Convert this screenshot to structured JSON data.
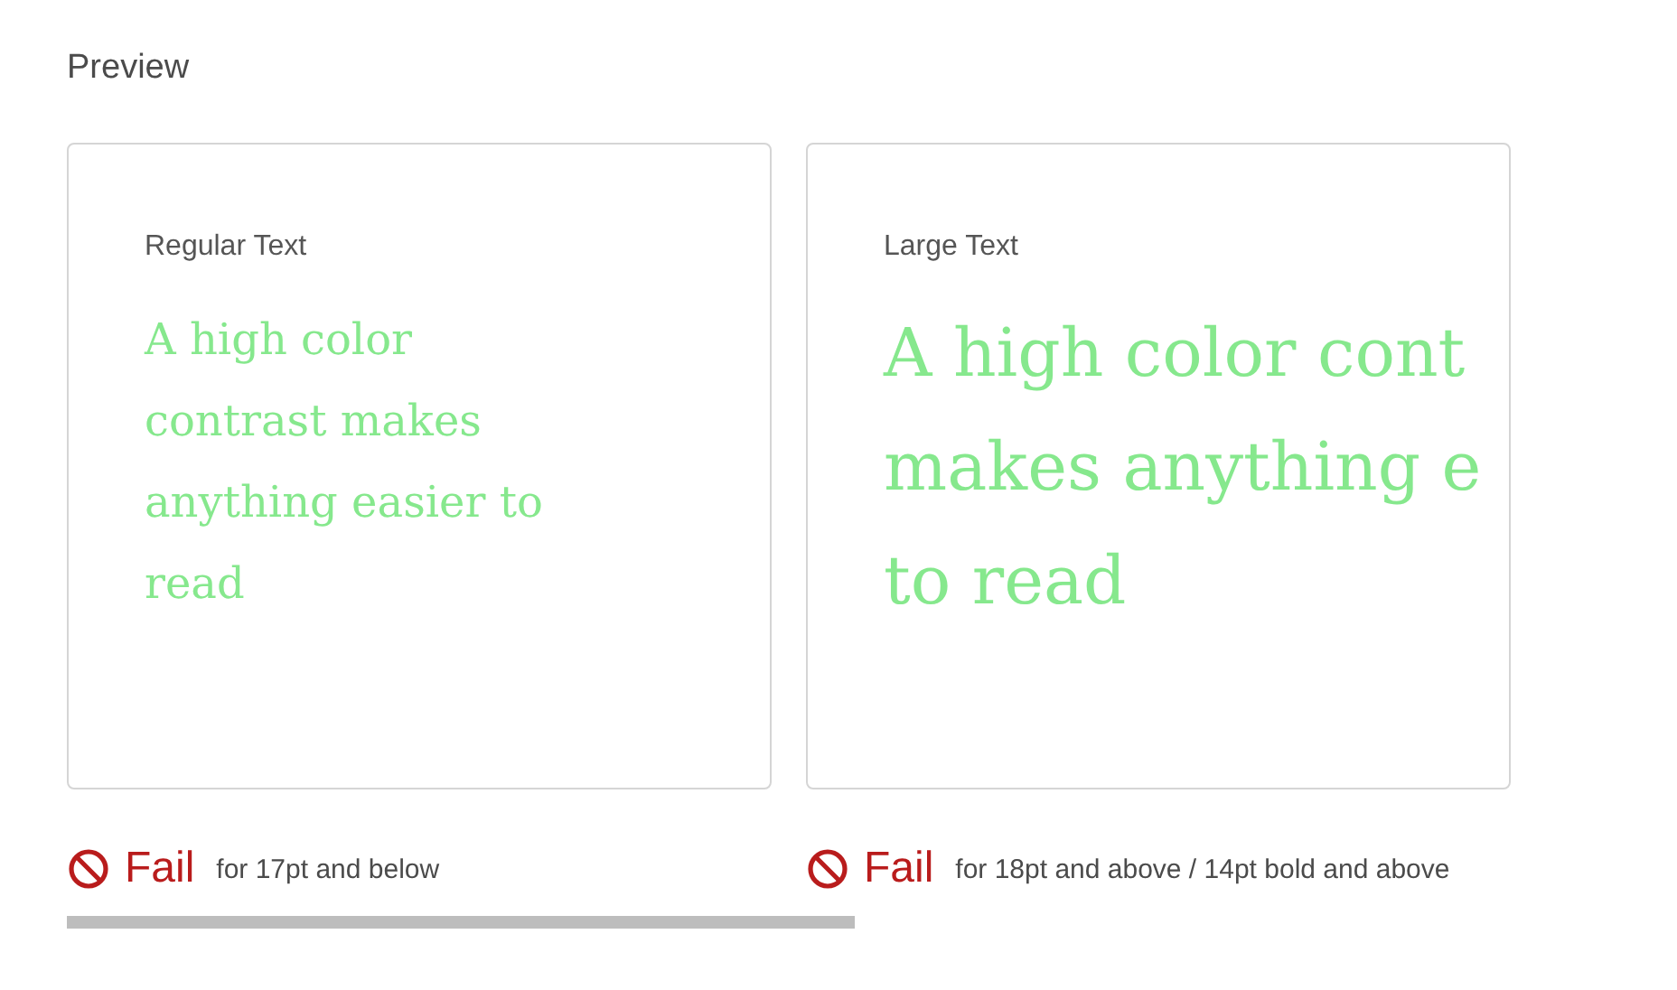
{
  "title": "Preview",
  "cards": [
    {
      "label": "Regular Text",
      "kind": "regular",
      "lines": [
        "A high color",
        "contrast makes",
        "anything easier to",
        "read"
      ],
      "result": {
        "kind": "fail",
        "text": "Fail",
        "note": "for 17pt and below"
      }
    },
    {
      "label": "Large Text",
      "kind": "large",
      "lines": [
        "A high color cont",
        "makes anything e",
        "to read"
      ],
      "result": {
        "kind": "fail",
        "text": "Fail",
        "note": "for 18pt and above / 14pt bold and above"
      }
    }
  ]
}
